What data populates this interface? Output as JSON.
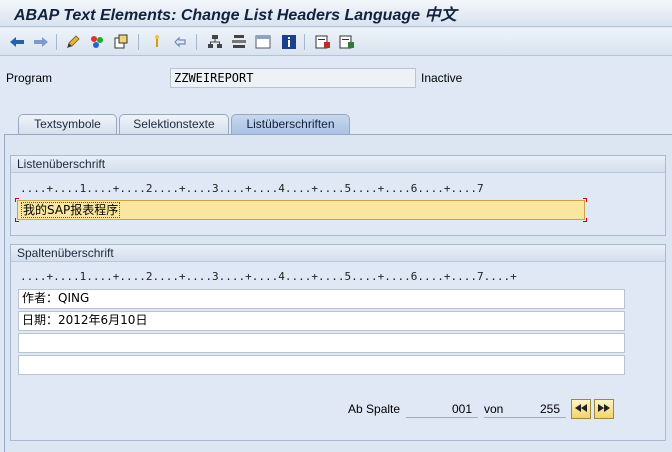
{
  "window": {
    "title": "ABAP Text Elements: Change List Headers Language 中文"
  },
  "toolbar": {
    "icons": [
      "back-arrow-icon",
      "forward-arrow-icon",
      "edit-pencil-icon",
      "test-icon",
      "object-list-icon",
      "where-used-icon",
      "check-icon",
      "hierarchy-icon",
      "layout-icon",
      "window-icon",
      "info-icon",
      "save-translation-icon",
      "compare-icon"
    ]
  },
  "program": {
    "label": "Program",
    "value": "ZZWEIREPORT",
    "status": "Inactive"
  },
  "tabs": [
    {
      "label": "Textsymbole"
    },
    {
      "label": "Selektionstexte"
    },
    {
      "label": "Listüberschriften"
    }
  ],
  "list_header": {
    "title": "Listenüberschrift",
    "ruler": "....+....1....+....2....+....3....+....4....+....5....+....6....+....7",
    "value": "我的SAP报表程序"
  },
  "column_header": {
    "title": "Spaltenüberschrift",
    "ruler": "....+....1....+....2....+....3....+....4....+....5....+....6....+....7....+",
    "rows": [
      "作者：QING",
      "日期：2012年6月10日",
      "",
      ""
    ]
  },
  "navigation": {
    "ab_spalte_label": "Ab Spalte",
    "ab_spalte_value": "001",
    "von_label": "von",
    "von_value": "255"
  },
  "colors": {
    "accent": "#a9c1e3",
    "highlight": "#fbe6a0",
    "background": "#dfe8f4"
  }
}
